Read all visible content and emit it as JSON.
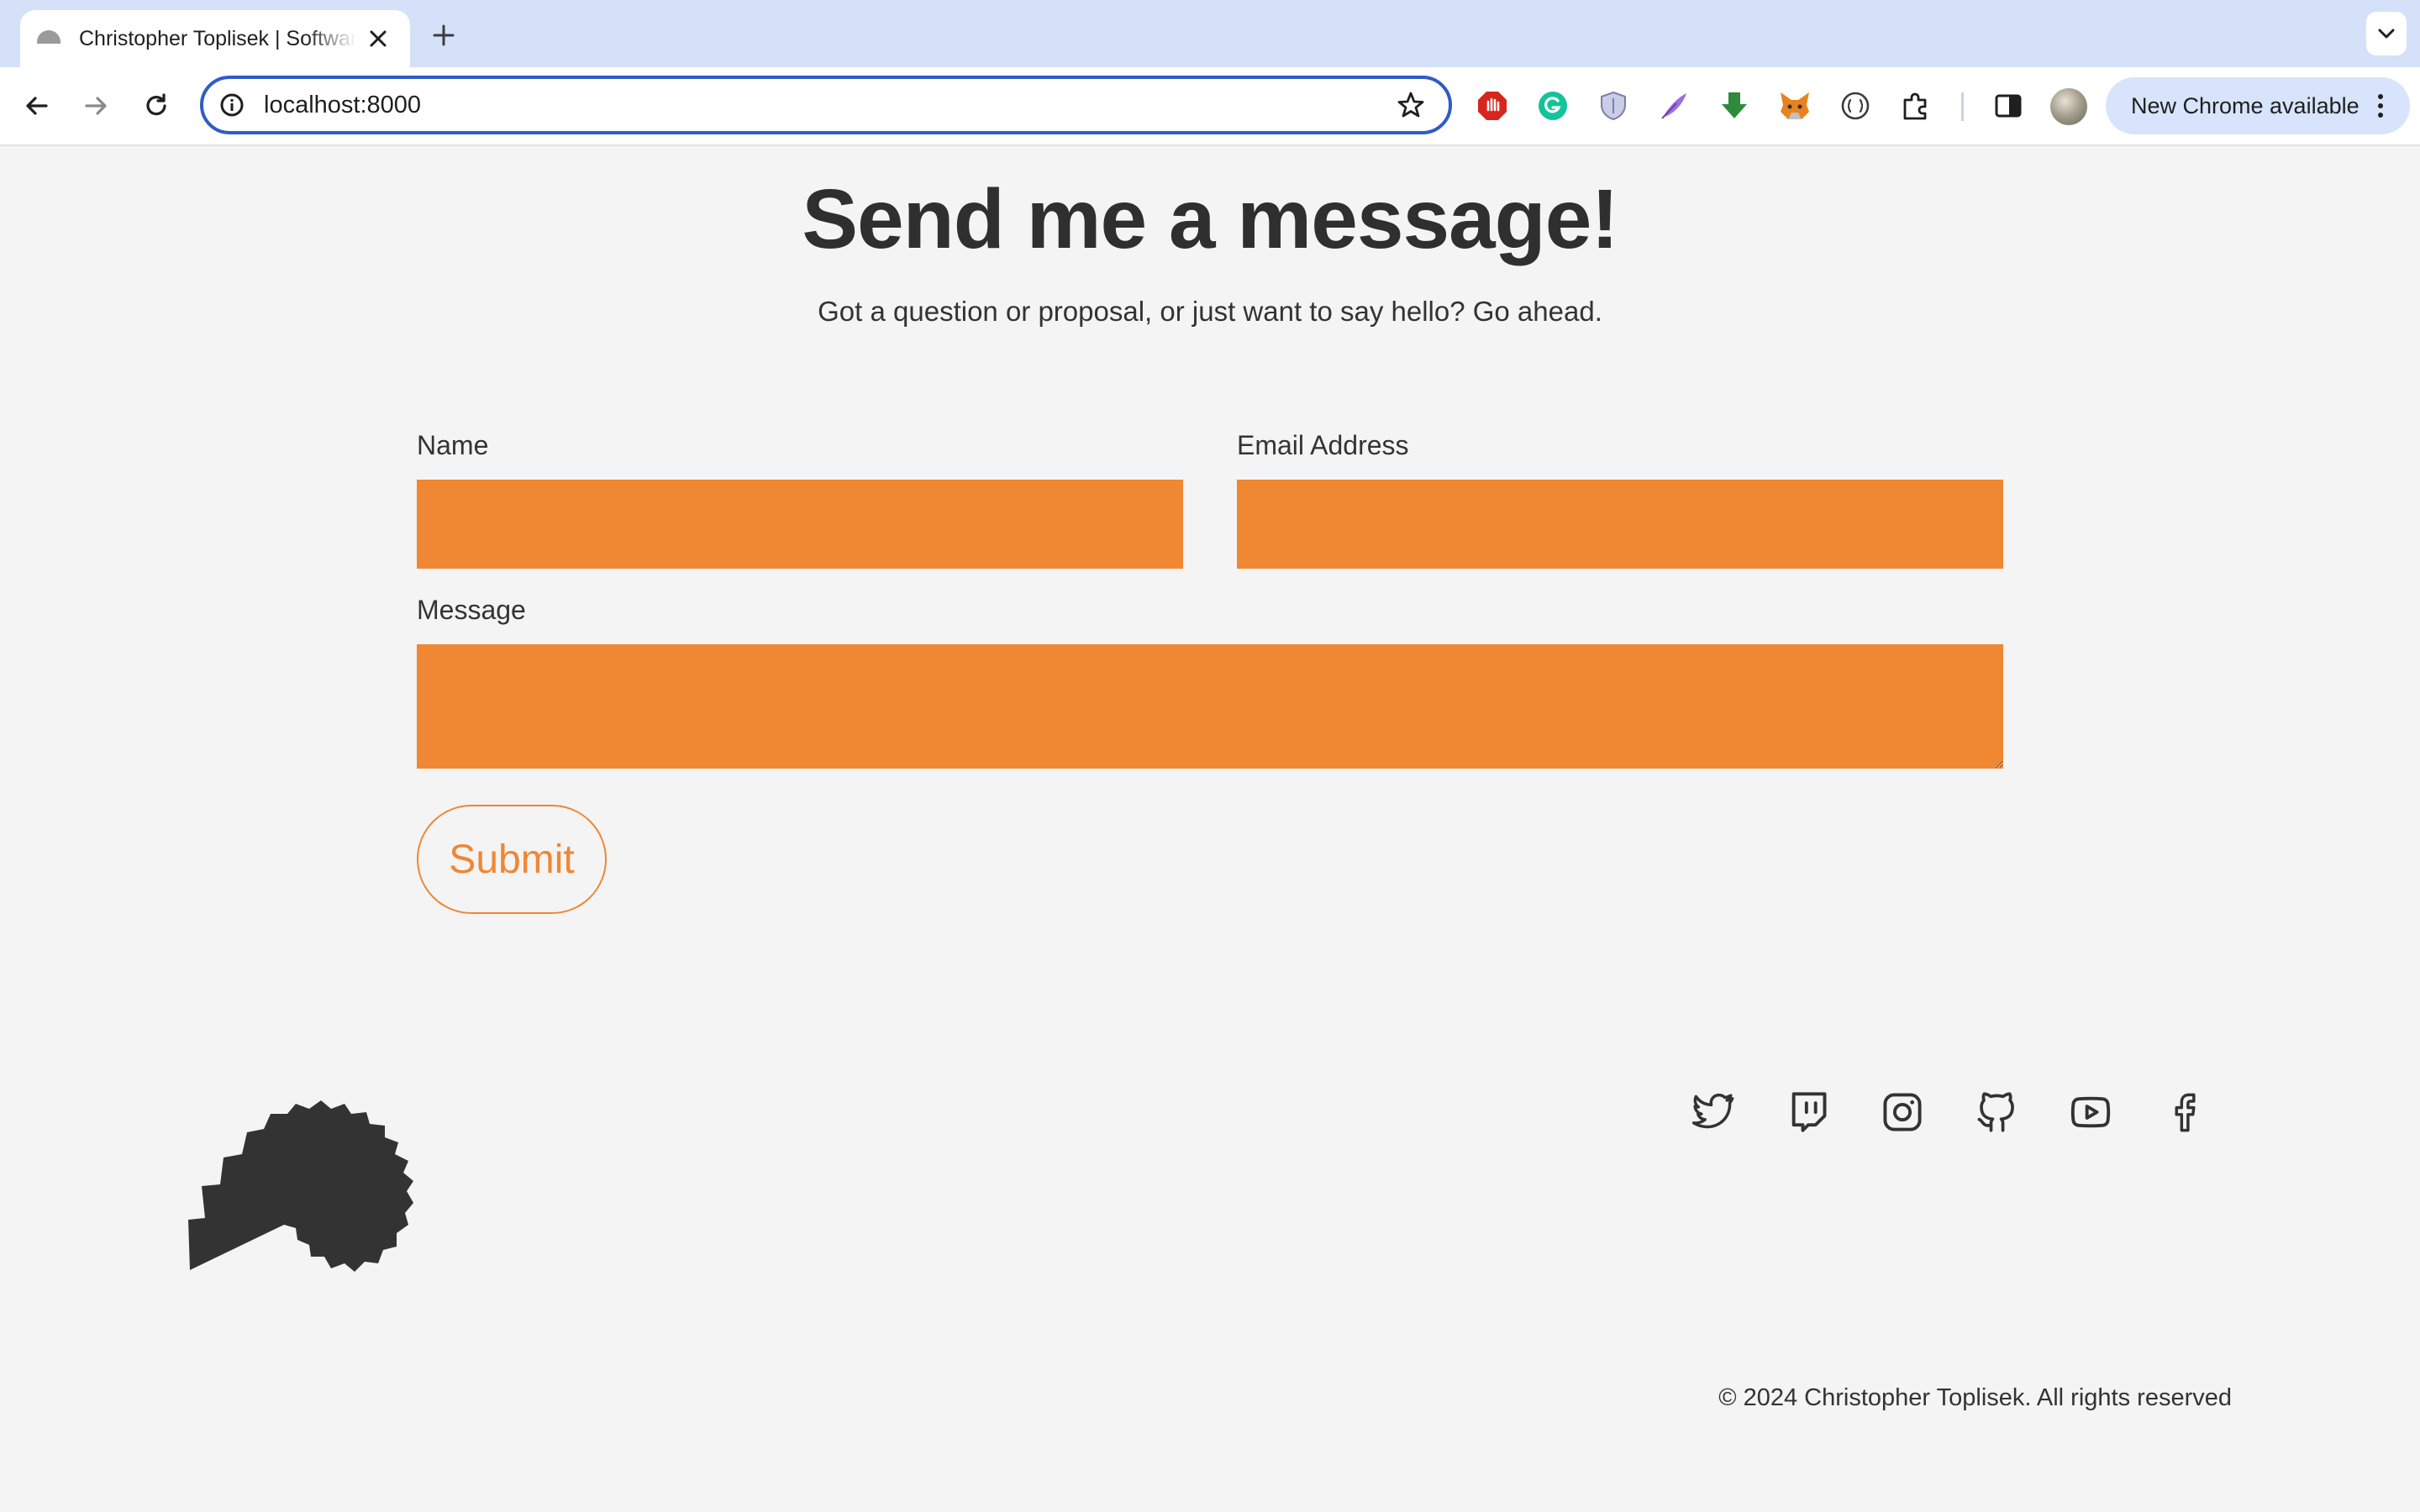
{
  "browser": {
    "tab_title": "Christopher Toplisek | Software Engineer",
    "url": "localhost:8000",
    "update_chip_label": "New Chrome available"
  },
  "page": {
    "heading": "Send me a message!",
    "subheading": "Got a question or proposal, or just want to say hello? Go ahead.",
    "form": {
      "name_label": "Name",
      "name_value": "",
      "email_label": "Email Address",
      "email_value": "",
      "message_label": "Message",
      "message_value": "",
      "submit_label": "Submit"
    },
    "footer": {
      "social_icons": [
        "twitter-icon",
        "twitch-icon",
        "instagram-icon",
        "github-icon",
        "youtube-icon",
        "facebook-icon"
      ],
      "copyright": "© 2024 Christopher Toplisek. All rights reserved"
    }
  },
  "colors": {
    "accent": "#ef8733",
    "text": "#333333",
    "background": "#f4f4f4",
    "tabstrip": "#d4e1f9"
  }
}
